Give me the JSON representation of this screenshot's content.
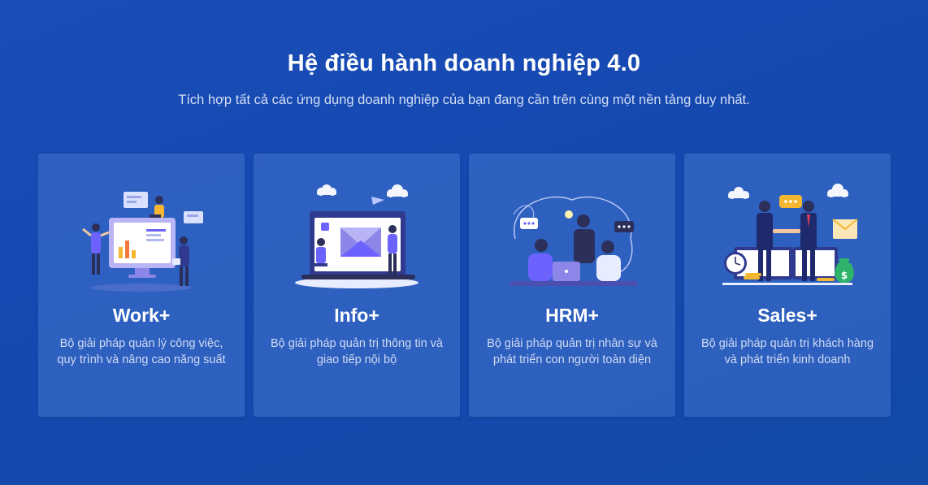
{
  "header": {
    "title": "Hệ điều hành doanh nghiệp 4.0",
    "subtitle": "Tích hợp tất cả các ứng dụng doanh nghiệp của bạn đang cần trên cùng một nền tảng duy nhất."
  },
  "cards": [
    {
      "title": "Work+",
      "desc_line1": "Bộ giải pháp quản lý công việc,",
      "desc_line2": "quy trình và nâng cao năng suất",
      "illustration": "team-dashboard-illustration"
    },
    {
      "title": "Info+",
      "desc_line1": "Bộ giải pháp quản trị thông tin và",
      "desc_line2": "giao tiếp nội bộ",
      "illustration": "laptop-mail-illustration"
    },
    {
      "title": "HRM+",
      "desc_line1": "Bộ giải pháp quản trị nhân sự và",
      "desc_line2": "phát triển con người toàn diện",
      "illustration": "team-meeting-illustration"
    },
    {
      "title": "Sales+",
      "desc_line1": "Bộ giải pháp quản trị khách hàng",
      "desc_line2": "và phát triển kinh doanh",
      "illustration": "handshake-deal-illustration"
    }
  ],
  "colors": {
    "background": "#1549b0",
    "card": "#3a6cc8",
    "accent_purple": "#6c63ff",
    "accent_yellow": "#f5b731",
    "accent_green": "#2fb36b"
  }
}
